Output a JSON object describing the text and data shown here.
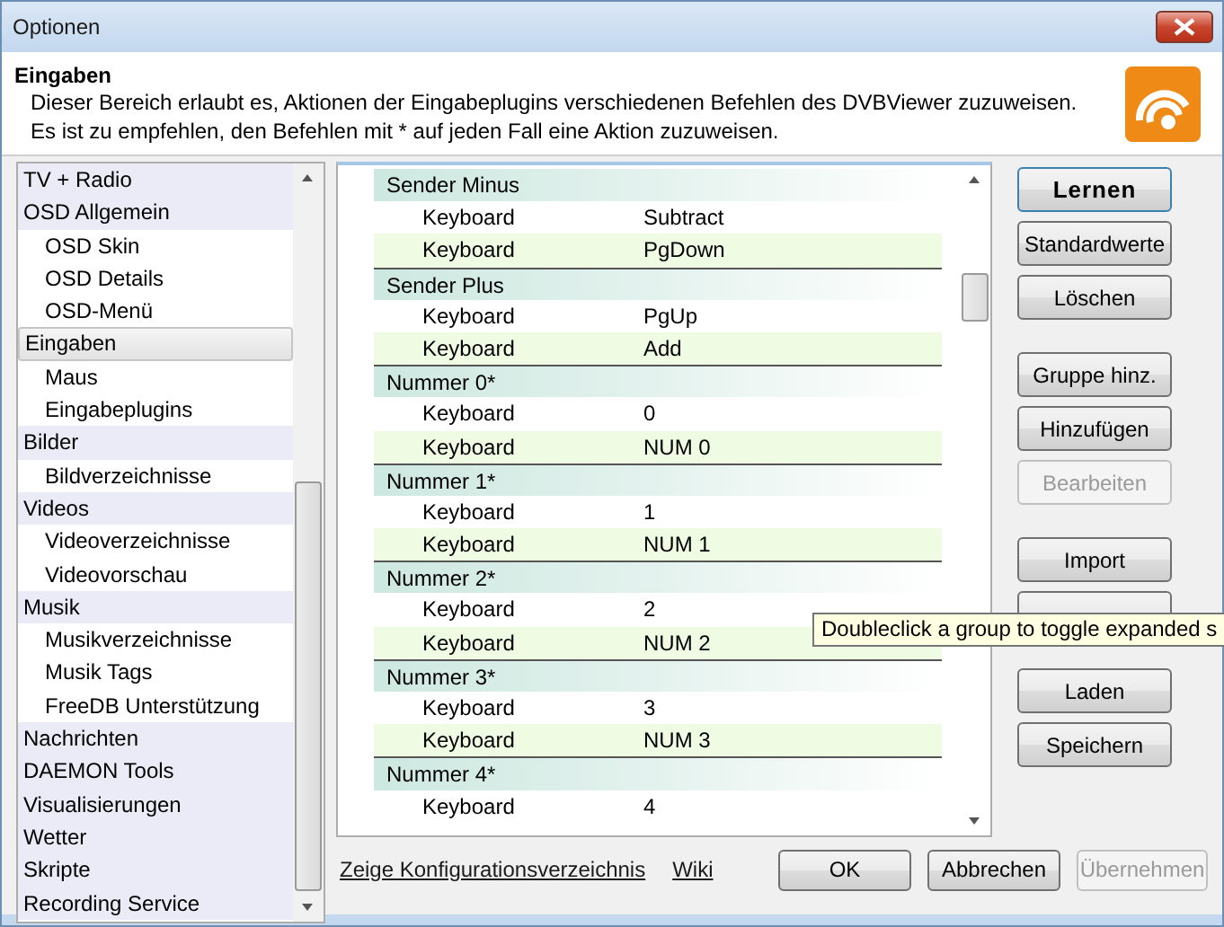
{
  "window": {
    "title": "Optionen"
  },
  "header": {
    "title": "Eingaben",
    "lines": [
      "Dieser Bereich erlaubt es, Aktionen der Eingabeplugins verschiedenen Befehlen des DVBViewer zuzuweisen.",
      "Es ist zu empfehlen, den Befehlen mit * auf jeden Fall eine Aktion zuzuweisen."
    ]
  },
  "sidebar": {
    "items": [
      {
        "label": "TV + Radio",
        "selected": false
      },
      {
        "label": "OSD Allgemein",
        "selected": false,
        "children": [
          {
            "label": "OSD Skin",
            "selected": false
          },
          {
            "label": "OSD Details",
            "selected": false
          },
          {
            "label": "OSD-Menü",
            "selected": false
          }
        ]
      },
      {
        "label": "Eingaben",
        "selected": true,
        "children": [
          {
            "label": "Maus",
            "selected": false
          },
          {
            "label": "Eingabeplugins",
            "selected": false
          }
        ]
      },
      {
        "label": "Bilder",
        "selected": false,
        "children": [
          {
            "label": "Bildverzeichnisse",
            "selected": false
          }
        ]
      },
      {
        "label": "Videos",
        "selected": false,
        "children": [
          {
            "label": "Videoverzeichnisse",
            "selected": false
          },
          {
            "label": "Videovorschau",
            "selected": false
          }
        ]
      },
      {
        "label": "Musik",
        "selected": false,
        "children": [
          {
            "label": "Musikverzeichnisse",
            "selected": false
          },
          {
            "label": "Musik Tags",
            "selected": false
          },
          {
            "label": "FreeDB Unterstützung",
            "selected": false
          }
        ]
      },
      {
        "label": "Nachrichten",
        "selected": false
      },
      {
        "label": "DAEMON Tools",
        "selected": false
      },
      {
        "label": "Visualisierungen",
        "selected": false
      },
      {
        "label": "Wetter",
        "selected": false
      },
      {
        "label": "Skripte",
        "selected": false
      },
      {
        "label": "Recording Service",
        "selected": false
      }
    ]
  },
  "bindings": {
    "groups": [
      {
        "name": "Sender Minus",
        "rows": [
          {
            "device": "Keyboard",
            "key": "Subtract"
          },
          {
            "device": "Keyboard",
            "key": "PgDown"
          }
        ]
      },
      {
        "name": "Sender Plus",
        "rows": [
          {
            "device": "Keyboard",
            "key": "PgUp"
          },
          {
            "device": "Keyboard",
            "key": "Add"
          }
        ]
      },
      {
        "name": "Nummer 0*",
        "rows": [
          {
            "device": "Keyboard",
            "key": "0"
          },
          {
            "device": "Keyboard",
            "key": "NUM 0"
          }
        ]
      },
      {
        "name": "Nummer 1*",
        "rows": [
          {
            "device": "Keyboard",
            "key": "1"
          },
          {
            "device": "Keyboard",
            "key": "NUM 1"
          }
        ]
      },
      {
        "name": "Nummer 2*",
        "rows": [
          {
            "device": "Keyboard",
            "key": "2"
          },
          {
            "device": "Keyboard",
            "key": "NUM 2"
          }
        ]
      },
      {
        "name": "Nummer 3*",
        "rows": [
          {
            "device": "Keyboard",
            "key": "3"
          },
          {
            "device": "Keyboard",
            "key": "NUM 3"
          }
        ]
      },
      {
        "name": "Nummer 4*",
        "rows": [
          {
            "device": "Keyboard",
            "key": "4"
          }
        ]
      }
    ]
  },
  "side_buttons": [
    {
      "label": "Lernen",
      "default": true,
      "disabled": false
    },
    {
      "label": "Standardwerte",
      "default": false,
      "disabled": false
    },
    {
      "label": "Löschen",
      "default": false,
      "disabled": false
    },
    {
      "label": "Gruppe hinz.",
      "default": false,
      "disabled": false
    },
    {
      "label": "Hinzufügen",
      "default": false,
      "disabled": false
    },
    {
      "label": "Bearbeiten",
      "default": false,
      "disabled": true
    },
    {
      "label": "Import",
      "default": false,
      "disabled": false
    },
    {
      "default": false,
      "disabled": false
    },
    {
      "label": "Laden",
      "default": false,
      "disabled": false
    },
    {
      "label": "Speichern",
      "default": false,
      "disabled": false
    }
  ],
  "tooltip": {
    "text": "Doubleclick a group to toggle expanded s"
  },
  "footer": {
    "links": [
      "Zeige Konfigurationsverzeichnis",
      "Wiki"
    ],
    "buttons": [
      {
        "label": "OK",
        "disabled": false
      },
      {
        "label": "Abbrechen",
        "disabled": false
      },
      {
        "label": "Übernehmen",
        "disabled": true
      }
    ]
  }
}
